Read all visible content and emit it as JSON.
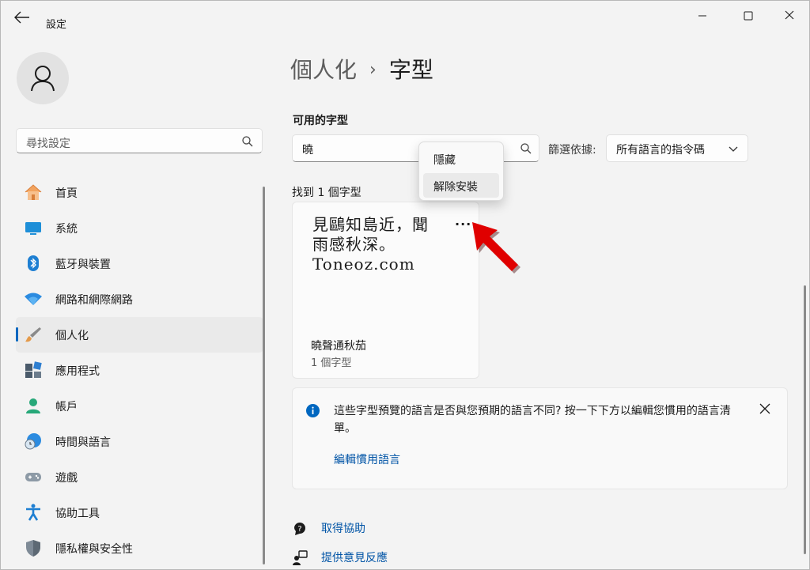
{
  "window": {
    "title": "設定"
  },
  "sidebar": {
    "search": {
      "placeholder": "尋找設定"
    },
    "items": [
      {
        "label": "首頁",
        "icon": "home-icon"
      },
      {
        "label": "系統",
        "icon": "system-icon"
      },
      {
        "label": "藍牙與裝置",
        "icon": "bluetooth-icon"
      },
      {
        "label": "網路和網際網路",
        "icon": "wifi-icon"
      },
      {
        "label": "個人化",
        "icon": "brush-icon",
        "active": true
      },
      {
        "label": "應用程式",
        "icon": "apps-icon"
      },
      {
        "label": "帳戶",
        "icon": "account-icon"
      },
      {
        "label": "時間與語言",
        "icon": "time-language-icon"
      },
      {
        "label": "遊戲",
        "icon": "gamepad-icon"
      },
      {
        "label": "協助工具",
        "icon": "accessibility-icon"
      },
      {
        "label": "隱私權與安全性",
        "icon": "shield-icon"
      }
    ]
  },
  "breadcrumb": {
    "parent": "個人化",
    "separator": "›",
    "current": "字型"
  },
  "fonts": {
    "section_title": "可用的字型",
    "search_value": "曉",
    "filter_label": "篩選依據:",
    "filter_value": "所有語言的指令碼",
    "found_text": "找到 1 個字型",
    "card": {
      "preview_line1": "見鷗知島近，聞",
      "preview_line2": "雨感秋深。",
      "preview_line3": "Toneoz.com",
      "more": "···",
      "name": "曉聲通秋茄",
      "count": "1 個字型"
    },
    "context_menu": {
      "hide": "隱藏",
      "uninstall": "解除安裝"
    }
  },
  "info_bar": {
    "text": "這些字型預覽的語言是否與您預期的語言不同? 按一下下方以編輯您慣用的語言清單。",
    "link": "編輯慣用語言"
  },
  "footer": {
    "help": "取得協助",
    "feedback": "提供意見反應"
  },
  "colors": {
    "accent": "#0067c0",
    "annotation_arrow": "#e00000"
  }
}
